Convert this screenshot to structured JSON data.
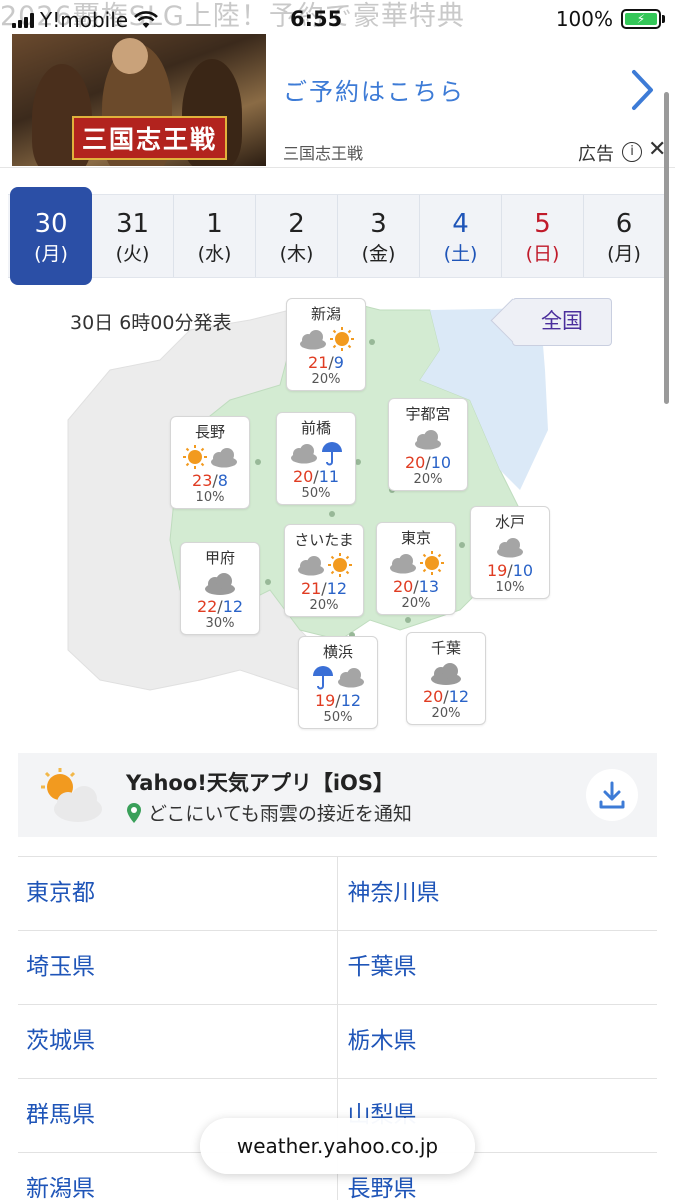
{
  "status_bar": {
    "ghost_text": "2026覇権SLG上陸！予約で豪華特典",
    "carrier": "Y!mobile",
    "time": "6:55",
    "battery": "100%"
  },
  "ad": {
    "image_logo": "三国志王戦",
    "cta": "ご予約はこちら",
    "sponsor": "三国志王戦",
    "label": "広告"
  },
  "date_tabs": [
    {
      "day": "30",
      "weekday": "(月)",
      "state": "selected"
    },
    {
      "day": "31",
      "weekday": "(火)",
      "state": "normal"
    },
    {
      "day": "1",
      "weekday": "(水)",
      "state": "normal"
    },
    {
      "day": "2",
      "weekday": "(木)",
      "state": "normal"
    },
    {
      "day": "3",
      "weekday": "(金)",
      "state": "normal"
    },
    {
      "day": "4",
      "weekday": "(土)",
      "state": "saturday"
    },
    {
      "day": "5",
      "weekday": "(日)",
      "state": "sunday"
    },
    {
      "day": "6",
      "weekday": "(月)",
      "state": "normal"
    }
  ],
  "map": {
    "issued": "30日 6時00分発表",
    "zenkoku_button": "全国",
    "cities": [
      {
        "name": "新潟",
        "icons": [
          "cloud",
          "sun"
        ],
        "high": "21",
        "low": "9",
        "pop": "20%"
      },
      {
        "name": "長野",
        "icons": [
          "sun",
          "cloud"
        ],
        "high": "23",
        "low": "8",
        "pop": "10%"
      },
      {
        "name": "前橋",
        "icons": [
          "cloud",
          "umbrella"
        ],
        "high": "20",
        "low": "11",
        "pop": "50%"
      },
      {
        "name": "宇都宮",
        "icons": [
          "cloud"
        ],
        "high": "20",
        "low": "10",
        "pop": "20%"
      },
      {
        "name": "水戸",
        "icons": [
          "cloud"
        ],
        "high": "19",
        "low": "10",
        "pop": "10%"
      },
      {
        "name": "甲府",
        "icons": [
          "cloud-dark"
        ],
        "high": "22",
        "low": "12",
        "pop": "30%"
      },
      {
        "name": "さいたま",
        "icons": [
          "cloud",
          "sun"
        ],
        "high": "21",
        "low": "12",
        "pop": "20%"
      },
      {
        "name": "東京",
        "icons": [
          "cloud",
          "sun"
        ],
        "high": "20",
        "low": "13",
        "pop": "20%"
      },
      {
        "name": "横浜",
        "icons": [
          "umbrella",
          "cloud"
        ],
        "high": "19",
        "low": "12",
        "pop": "50%"
      },
      {
        "name": "千葉",
        "icons": [
          "cloud-dark"
        ],
        "high": "20",
        "low": "12",
        "pop": "20%"
      }
    ]
  },
  "app_promo": {
    "title": "Yahoo!天気アプリ【iOS】",
    "subtitle": "どこにいても雨雲の接近を通知"
  },
  "prefectures": [
    [
      "東京都",
      "神奈川県"
    ],
    [
      "埼玉県",
      "千葉県"
    ],
    [
      "茨城県",
      "栃木県"
    ],
    [
      "群馬県",
      "山梨県"
    ],
    [
      "新潟県",
      "長野県"
    ]
  ],
  "url_bar": "weather.yahoo.co.jp",
  "colors": {
    "selected_tab": "#2b4fa6",
    "link": "#1f55b8",
    "high_temp": "#e03c22",
    "low_temp": "#2a63c8",
    "map_land": "#d5ecd4",
    "map_sea": "#dbe9f7"
  }
}
